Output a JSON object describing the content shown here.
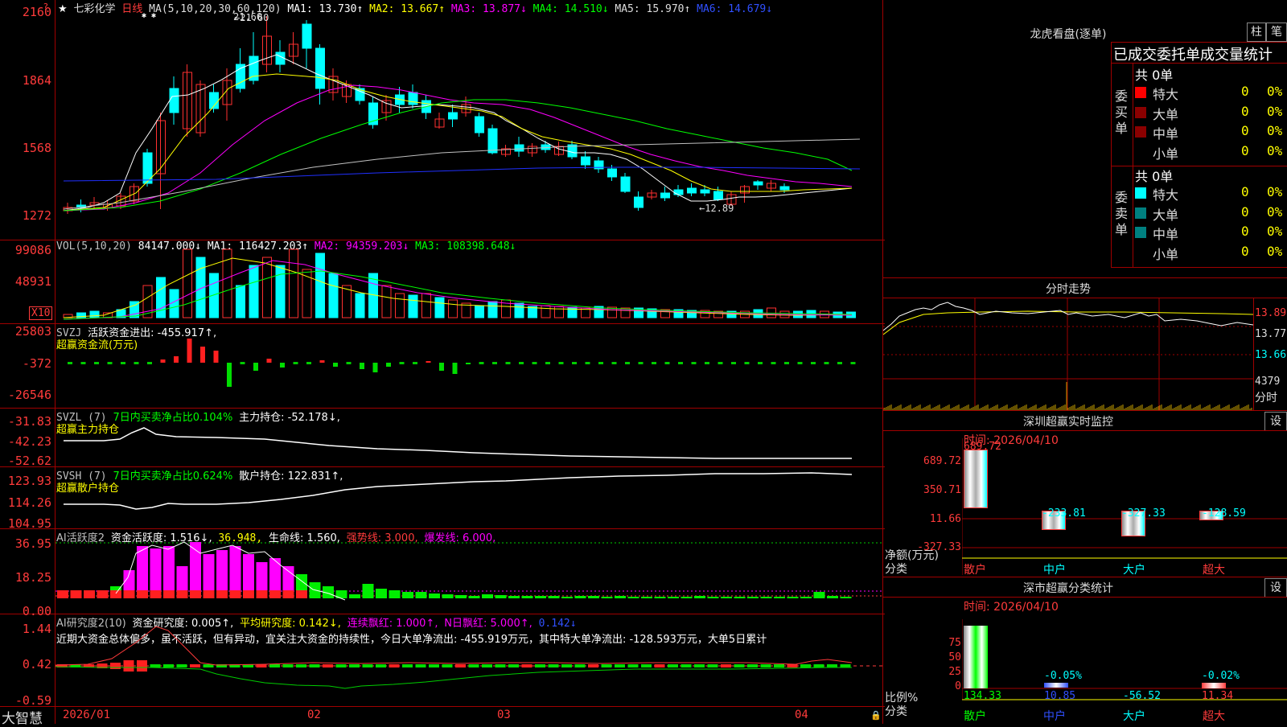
{
  "main": {
    "stock_name": "七彩化学",
    "period": "日线",
    "ma_params": "MA(5,10,20,30,60,120)",
    "ma1": "MA1: 13.730↑",
    "ma2": "MA2: 13.667↑",
    "ma3": "MA3: 13.877↓",
    "ma4": "MA4: 14.510↓",
    "ma5": "MA5: 15.970↑",
    "ma6": "MA6: 14.679↓",
    "high_label": "21.60",
    "low_label": "←12.89",
    "axis": [
      "2160",
      "1864",
      "1568",
      "1272"
    ]
  },
  "vol": {
    "header": "VOL(5,10,20)",
    "value": "84147.000↓",
    "ma1": "MA1: 116427.203↑",
    "ma2": "MA2: 94359.203↓",
    "ma3": "MA3: 108398.648↓",
    "axis": [
      "99086",
      "48931"
    ],
    "unit": "X10"
  },
  "svzj": {
    "header": "SVZJ",
    "label": "活跃资金进出: -455.917↑,",
    "sub": "超赢资金流(万元)",
    "axis": [
      "25803",
      "-372",
      "-26546"
    ]
  },
  "svzl": {
    "header": "SVZL (7)",
    "ratio": "7日内买卖净占比0.104%",
    "hold": "主力持仓: -52.178↓,",
    "sub": "超赢主力持仓",
    "axis": [
      "-31.83",
      "-42.23",
      "-52.62"
    ]
  },
  "svsh": {
    "header": "SVSH (7)",
    "ratio": "7日内买卖净占比0.624%",
    "hold": "散户持仓: 122.831↑,",
    "sub": "超赢散户持仓",
    "axis": [
      "123.93",
      "114.26",
      "104.95"
    ]
  },
  "ai1": {
    "header": "AI活跃度2",
    "active": "资金活跃度: 1.516↓,",
    "v2": "36.948,",
    "life": "生命线: 1.560,",
    "strong": "强势线: 3.000,",
    "burst": "爆发线: 6.000,",
    "axis": [
      "36.95",
      "18.25",
      "0.00"
    ]
  },
  "ai2": {
    "header": "AI研究度2(10)",
    "research": "资金研究度: 0.005↑,",
    "avg": "平均研究度: 0.142↓,",
    "cont": "连续飘红: 1.000↑,",
    "n": "N日飘红: 5.000↑,",
    "last": "0.142↓",
    "comment": "近期大资金总体偏多，虽不活跃，但有异动，宜关注大资金的持续性，今日大单净流出: -455.919万元，其中特大单净流出: -128.593万元，大单5日累计",
    "axis": [
      "1.44",
      "0.42",
      "-0.59"
    ]
  },
  "dates": [
    "2026/01",
    "02",
    "03",
    "04"
  ],
  "brand": "大智慧",
  "side": {
    "dragon": {
      "title": "龙虎看盘(逐单)",
      "btn1": "柱",
      "btn2": "笔",
      "tabs": "已成交委托单成交量统计",
      "buy_total": "共 0单",
      "sell_total": "共 0单",
      "buy_label": "委买单",
      "sell_label": "委卖单",
      "rows": [
        {
          "name": "特大",
          "value": "0",
          "pct": "0%"
        },
        {
          "name": "大单",
          "value": "0",
          "pct": "0%"
        },
        {
          "name": "中单",
          "value": "0",
          "pct": "0%"
        },
        {
          "name": "小单",
          "value": "0",
          "pct": "0%"
        }
      ],
      "buy_colors": [
        "#ff0000",
        "#8b0000",
        "#8b0000",
        "#000000"
      ],
      "sell_colors": [
        "#00ffff",
        "#008080",
        "#008080",
        "#000000"
      ]
    },
    "minute": {
      "title": "分时走势",
      "axis": [
        "13.89",
        "13.77",
        "13.66"
      ],
      "vol": "4379",
      "unit": "分时"
    },
    "monitor": {
      "title": "深圳超赢实时监控",
      "btn": "设",
      "time": "时间: 2026/04/10",
      "top": "689.72",
      "axis": [
        "689.72",
        "350.71",
        "11.66",
        "-327.33"
      ],
      "values": [
        "-233.81",
        "-327.33",
        "-128.59"
      ],
      "ylabel1": "净额(万元)",
      "ylabel2": "分类",
      "cats": [
        "散户",
        "中户",
        "大户",
        "超大"
      ]
    },
    "classify": {
      "title": "深市超赢分类统计",
      "btn": "设",
      "time": "时间: 2026/04/10",
      "axis": [
        "75",
        "50",
        "25",
        "0"
      ],
      "pcts": [
        "-0.05%",
        "-0.02%"
      ],
      "values": [
        "134.33",
        "10.85",
        "-56.52",
        "11.34"
      ],
      "ylabel1": "比例%",
      "ylabel2": "分类",
      "cats": [
        "散户",
        "中户",
        "大户",
        "超大"
      ]
    }
  }
}
